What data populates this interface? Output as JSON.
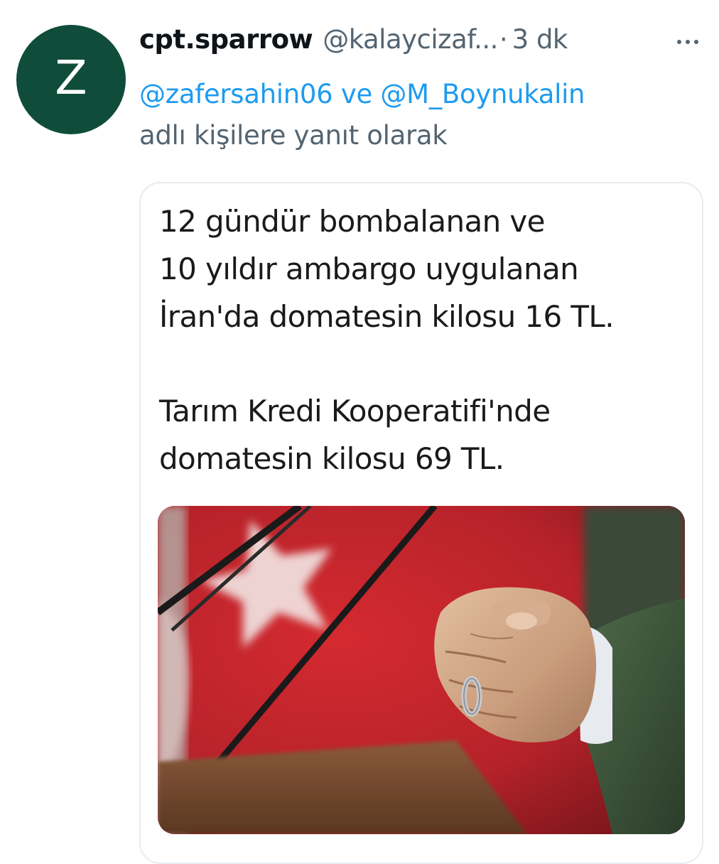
{
  "tweet": {
    "avatar_letter": "Z",
    "display_name": "cpt.sparrow",
    "handle": "@kalaycizaf...",
    "separator": "·",
    "time": "3 dk",
    "reply_mention_1": "@zafersahin06",
    "reply_joiner": " ve ",
    "reply_mention_2": "@M_Boynukalin",
    "reply_suffix": "adlı kişilere yanıt olarak"
  },
  "card": {
    "lines": [
      "12 gündür bombalanan ve",
      "10 yıldır ambargo uygulanan",
      "İran'da domatesin kilosu 16 TL.",
      "Tarım Kredi Kooperatifi'nde",
      "domatesin kilosu 69 TL."
    ]
  },
  "colors": {
    "avatar_bg": "#0f4d3a",
    "link": "#1d9bf0",
    "muted": "#536471",
    "flag_red": "#c8232b"
  },
  "icons": {
    "more": "more-horizontal-icon"
  }
}
